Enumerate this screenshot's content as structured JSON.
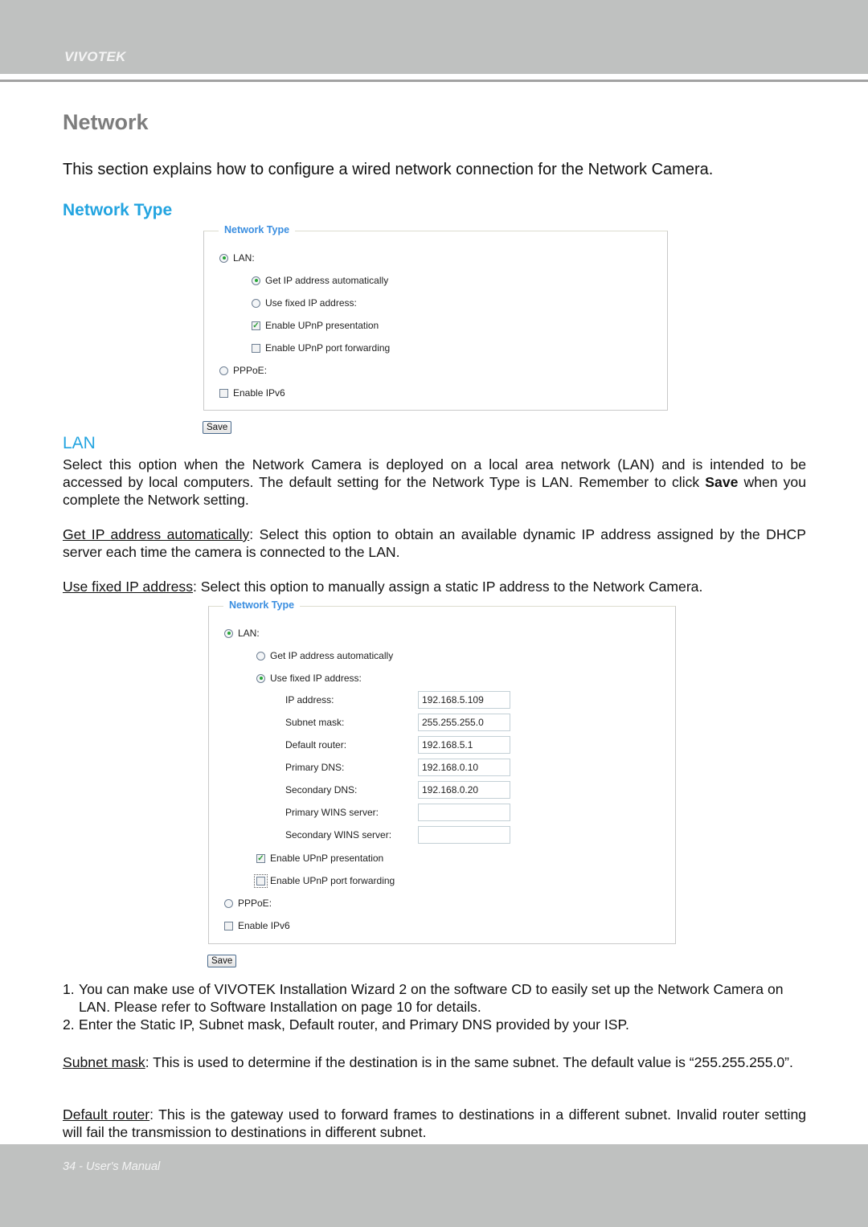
{
  "header": {
    "brand": "VIVOTEK"
  },
  "page": {
    "title": "Network",
    "intro": "This section explains how to configure a wired network connection for the Network Camera.",
    "section_heading": "Network Type",
    "lan_heading": "LAN"
  },
  "panel1": {
    "legend": "Network Type",
    "lan_label": "LAN:",
    "lan_selected": true,
    "get_ip_auto_label": "Get IP address automatically",
    "get_ip_auto_selected": true,
    "fixed_ip_label": "Use fixed IP address:",
    "fixed_ip_selected": false,
    "upnp_presentation_label": "Enable UPnP presentation",
    "upnp_presentation_checked": true,
    "upnp_port_forwarding_label": "Enable UPnP port forwarding",
    "upnp_port_forwarding_checked": false,
    "pppoe_label": "PPPoE:",
    "pppoe_selected": false,
    "ipv6_label": "Enable IPv6",
    "ipv6_checked": false,
    "save_label": "Save"
  },
  "lan_text": {
    "p1_a": "Select this option when the Network Camera is deployed on a local area network (LAN) and is intended to be accessed by local computers. The default setting for the Network Type is LAN. Remember to click ",
    "p1_bold": "Save",
    "p1_b": " when you complete the Network setting.",
    "p2_term": "Get IP address automatically",
    "p2_rest": ": Select this option to obtain an available dynamic IP address assigned by the DHCP server each time the camera is connected to the LAN.",
    "p3_term": "Use fixed IP address",
    "p3_rest": ": Select this option to manually assign a static IP address to the Network Camera."
  },
  "panel2": {
    "legend": "Network Type",
    "lan_label": "LAN:",
    "get_ip_auto_label": "Get IP address automatically",
    "fixed_ip_label": "Use fixed IP address:",
    "fields": [
      {
        "label": "IP address:",
        "value": "192.168.5.109"
      },
      {
        "label": "Subnet mask:",
        "value": "255.255.255.0"
      },
      {
        "label": "Default router:",
        "value": "192.168.5.1"
      },
      {
        "label": "Primary DNS:",
        "value": "192.168.0.10"
      },
      {
        "label": "Secondary DNS:",
        "value": "192.168.0.20"
      },
      {
        "label": "Primary WINS server:",
        "value": ""
      },
      {
        "label": "Secondary WINS server:",
        "value": ""
      }
    ],
    "upnp_presentation_label": "Enable UPnP presentation",
    "upnp_port_forwarding_label": "Enable UPnP port forwarding",
    "pppoe_label": "PPPoE:",
    "ipv6_label": "Enable IPv6",
    "save_label": "Save"
  },
  "notes": {
    "n1_num": "1.",
    "n1": "You can make use of VIVOTEK Installation Wizard 2 on the software CD to easily set up the Network Camera on LAN. Please refer to Software Installation on page 10 for details.",
    "n2_num": "2.",
    "n2": "Enter the Static IP, Subnet mask, Default router, and Primary DNS provided by your ISP.",
    "subnet_term": "Subnet mask",
    "subnet_rest": ": This is used to determine if the destination is in the same subnet. The default value is “255.255.255.0”.",
    "router_term": "Default router",
    "router_rest": ": This is the gateway used to forward frames to destinations in a different subnet. Invalid router setting will fail the transmission to destinations in different subnet."
  },
  "footer": {
    "text": "34 - User's Manual"
  },
  "colors": {
    "accent": "#23a4e0",
    "band": "#bfc1c0",
    "title_gray": "#7d7d7d",
    "legend_blue": "#3a8ee0",
    "check_green": "#27a637"
  }
}
